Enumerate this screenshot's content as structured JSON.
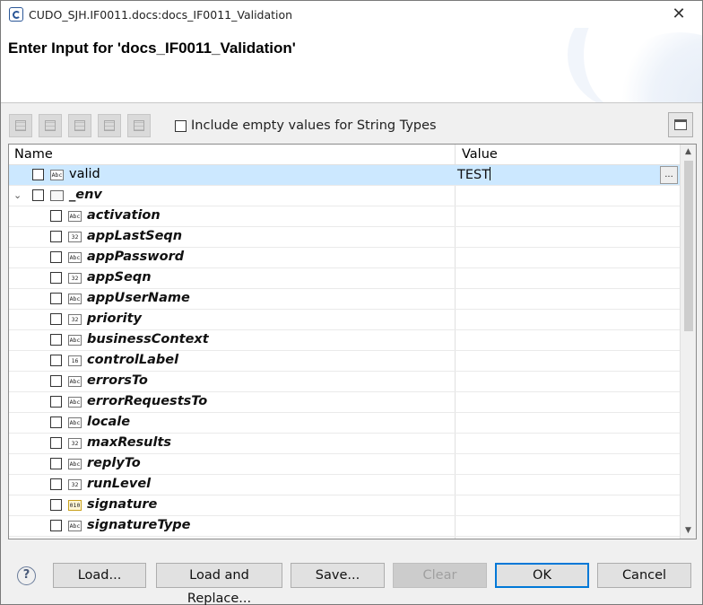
{
  "window": {
    "title": "CUDO_SJH.IF0011.docs:docs_IF0011_Validation",
    "close_glyph": "✕"
  },
  "header": {
    "title": "Enter Input for 'docs_IF0011_Validation'"
  },
  "toolbar": {
    "include_empty_label": "Include empty values for String Types",
    "include_empty_checked": false
  },
  "tree": {
    "columns": {
      "name": "Name",
      "value": "Value"
    },
    "rows": [
      {
        "name": "valid",
        "icon": "Abc",
        "value": "TEST",
        "level": 0,
        "selected": true
      },
      {
        "name": "_env",
        "icon": "doc",
        "value": "",
        "level": 0,
        "expanded": true
      },
      {
        "name": "activation",
        "icon": "Abc",
        "level": 1
      },
      {
        "name": "appLastSeqn",
        "icon": "32",
        "level": 1
      },
      {
        "name": "appPassword",
        "icon": "Abc",
        "level": 1
      },
      {
        "name": "appSeqn",
        "icon": "32",
        "level": 1
      },
      {
        "name": "appUserName",
        "icon": "Abc",
        "level": 1
      },
      {
        "name": "priority",
        "icon": "32",
        "level": 1
      },
      {
        "name": "businessContext",
        "icon": "Abc",
        "level": 1
      },
      {
        "name": "controlLabel",
        "icon": "16",
        "level": 1
      },
      {
        "name": "errorsTo",
        "icon": "Abc",
        "level": 1
      },
      {
        "name": "errorRequestsTo",
        "icon": "Abc",
        "level": 1
      },
      {
        "name": "locale",
        "icon": "Abc",
        "level": 1
      },
      {
        "name": "maxResults",
        "icon": "32",
        "level": 1
      },
      {
        "name": "replyTo",
        "icon": "Abc",
        "level": 1
      },
      {
        "name": "runLevel",
        "icon": "32",
        "level": 1
      },
      {
        "name": "signature",
        "icon": "010",
        "level": 1
      },
      {
        "name": "signatureType",
        "icon": "Abc",
        "level": 1
      }
    ],
    "value_button_label": "...",
    "expander_glyph": "⌄"
  },
  "footer": {
    "help_glyph": "?",
    "load_label": "Load...",
    "load_replace_label": "Load and Replace...",
    "save_label": "Save...",
    "clear_label": "Clear",
    "ok_label": "OK",
    "cancel_label": "Cancel"
  }
}
